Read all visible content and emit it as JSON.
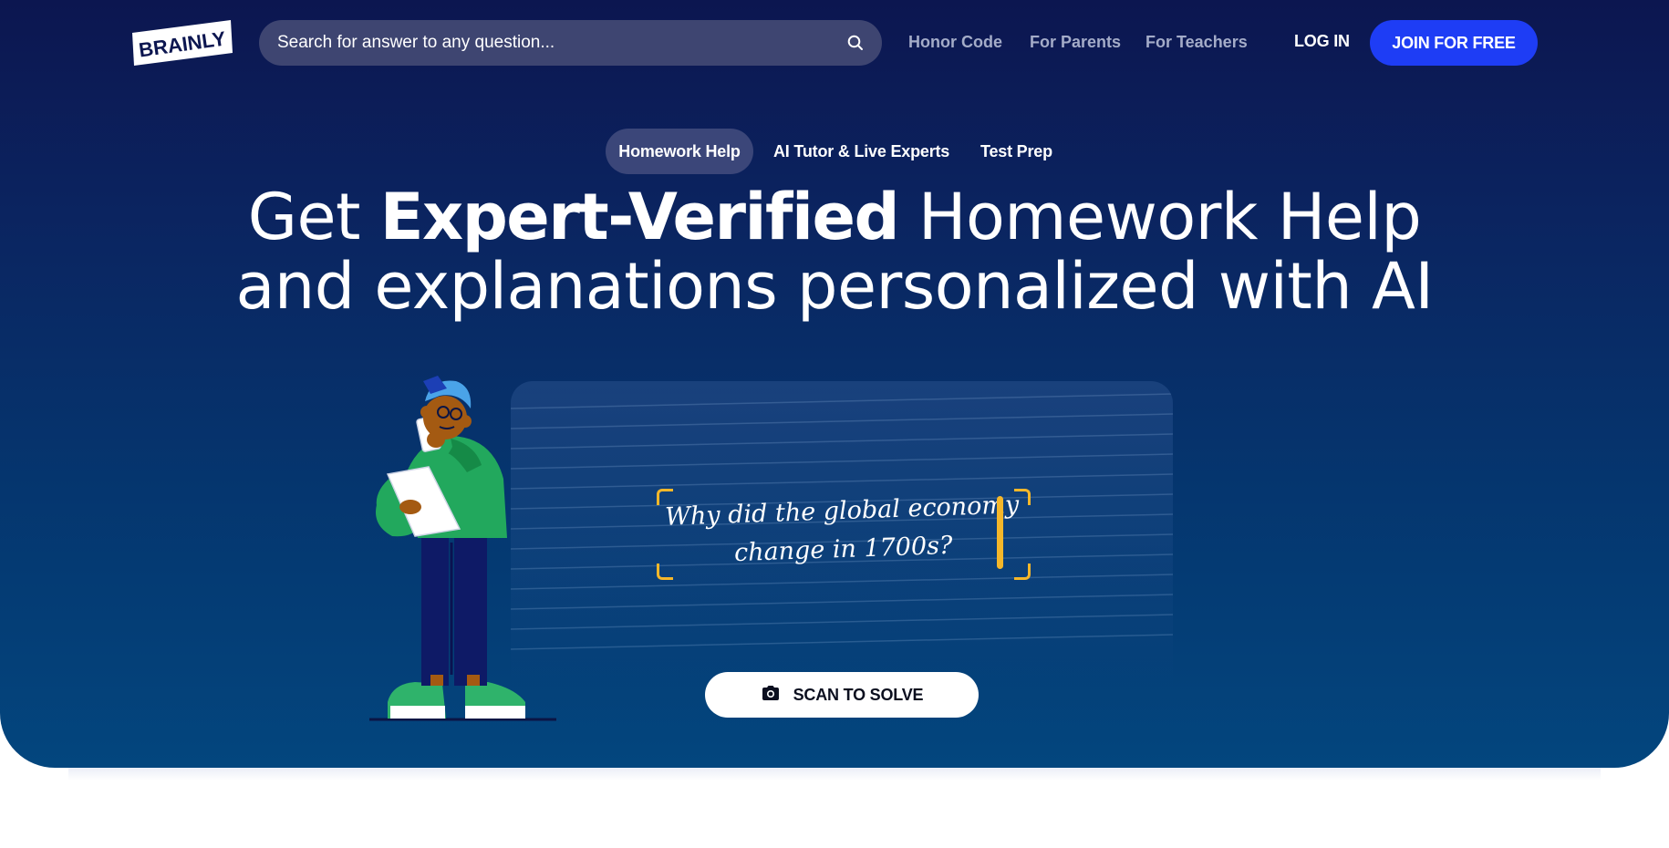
{
  "brand": {
    "logo_text": "BRAINLY"
  },
  "search": {
    "placeholder": "Search for answer to any question..."
  },
  "nav": {
    "links": [
      "Honor Code",
      "For Parents",
      "For Teachers"
    ],
    "login_label": "LOG IN",
    "join_label": "JOIN FOR FREE"
  },
  "tabs": [
    {
      "label": "Homework Help",
      "active": true
    },
    {
      "label": "AI Tutor & Live Experts",
      "active": false
    },
    {
      "label": "Test Prep",
      "active": false
    }
  ],
  "headline": {
    "prefix": "Get ",
    "emphasis": "Expert-Verified",
    "rest_line1": " Homework Help",
    "line2": "and explanations personalized with AI"
  },
  "question": {
    "line1": "Why did the global economy",
    "line2": "change in 1700s?"
  },
  "scan_button": {
    "label": "SCAN TO SOLVE",
    "icon": "camera-icon"
  },
  "colors": {
    "hero_top": "#0c1650",
    "hero_bottom": "#03467e",
    "join_button": "#1e3df5",
    "accent_yellow": "#f5b72a",
    "nav_link": "#a4acc8"
  }
}
